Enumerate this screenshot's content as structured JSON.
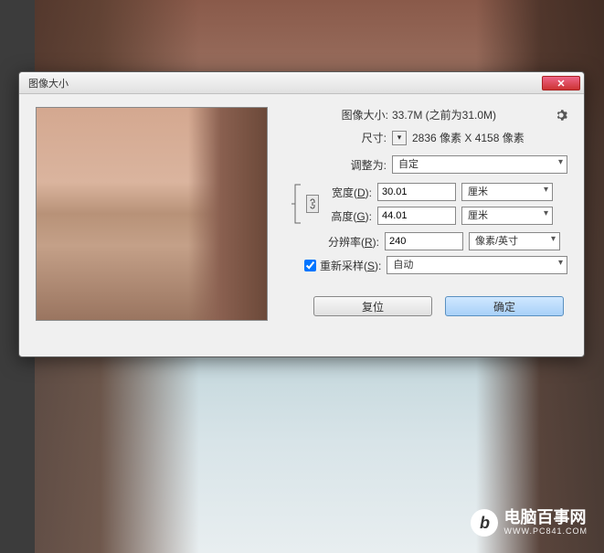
{
  "dialog": {
    "title": "图像大小",
    "info": {
      "label": "图像大小:",
      "value": "33.7M (之前为31.0M)"
    },
    "dimensions": {
      "label": "尺寸:",
      "value": "2836 像素 X 4158 像素"
    },
    "fit": {
      "label": "调整为:",
      "value": "自定"
    },
    "width": {
      "label_prefix": "宽度(",
      "label_key": "D",
      "label_suffix": "):",
      "value": "30.01",
      "unit": "厘米"
    },
    "height": {
      "label_prefix": "高度(",
      "label_key": "G",
      "label_suffix": "):",
      "value": "44.01",
      "unit": "厘米"
    },
    "resolution": {
      "label_prefix": "分辨率(",
      "label_key": "R",
      "label_suffix": "):",
      "value": "240",
      "unit": "像素/英寸"
    },
    "resample": {
      "label_prefix": "重新采样(",
      "label_key": "S",
      "label_suffix": "):",
      "value": "自动",
      "checked": true
    },
    "buttons": {
      "reset": "复位",
      "ok": "确定"
    }
  },
  "watermark": {
    "logo": "b",
    "main": "电脑百事网",
    "sub": "WWW.PC841.COM"
  }
}
